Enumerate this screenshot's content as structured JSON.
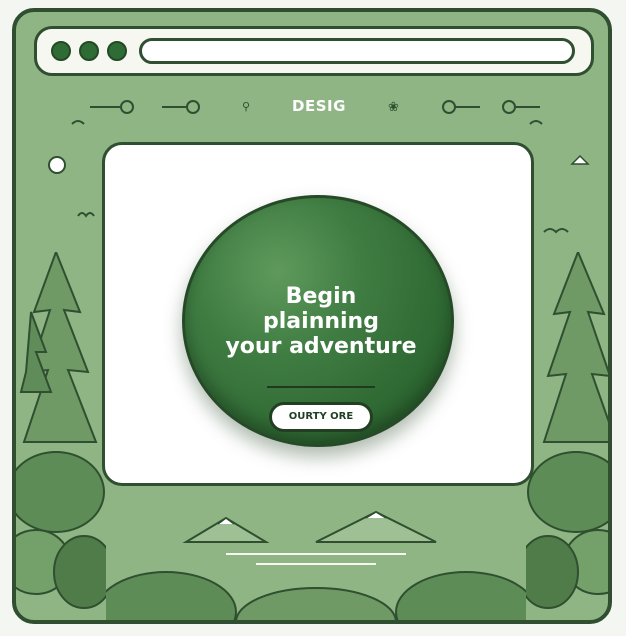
{
  "window": {
    "brand": "DESIG",
    "traffic_lights": [
      "dot-1",
      "dot-2",
      "dot-3"
    ]
  },
  "hero": {
    "headline_lines": [
      "Begin",
      "plainning",
      "your adventure"
    ],
    "cta_label": "OURTY ORE"
  },
  "colors": {
    "frame": "#8fb585",
    "outline": "#2f4f30",
    "button": "#3f7c42",
    "content_bg": "#ffffff"
  },
  "icons": {
    "nav_left": "slider-icon",
    "nav_mid_left": "pin-icon",
    "nav_mid_right": "leaf-icon",
    "nav_right": "slider-icon",
    "sun": "sun-icon",
    "birds": "bird-icon",
    "cloud": "cloud-icon"
  }
}
